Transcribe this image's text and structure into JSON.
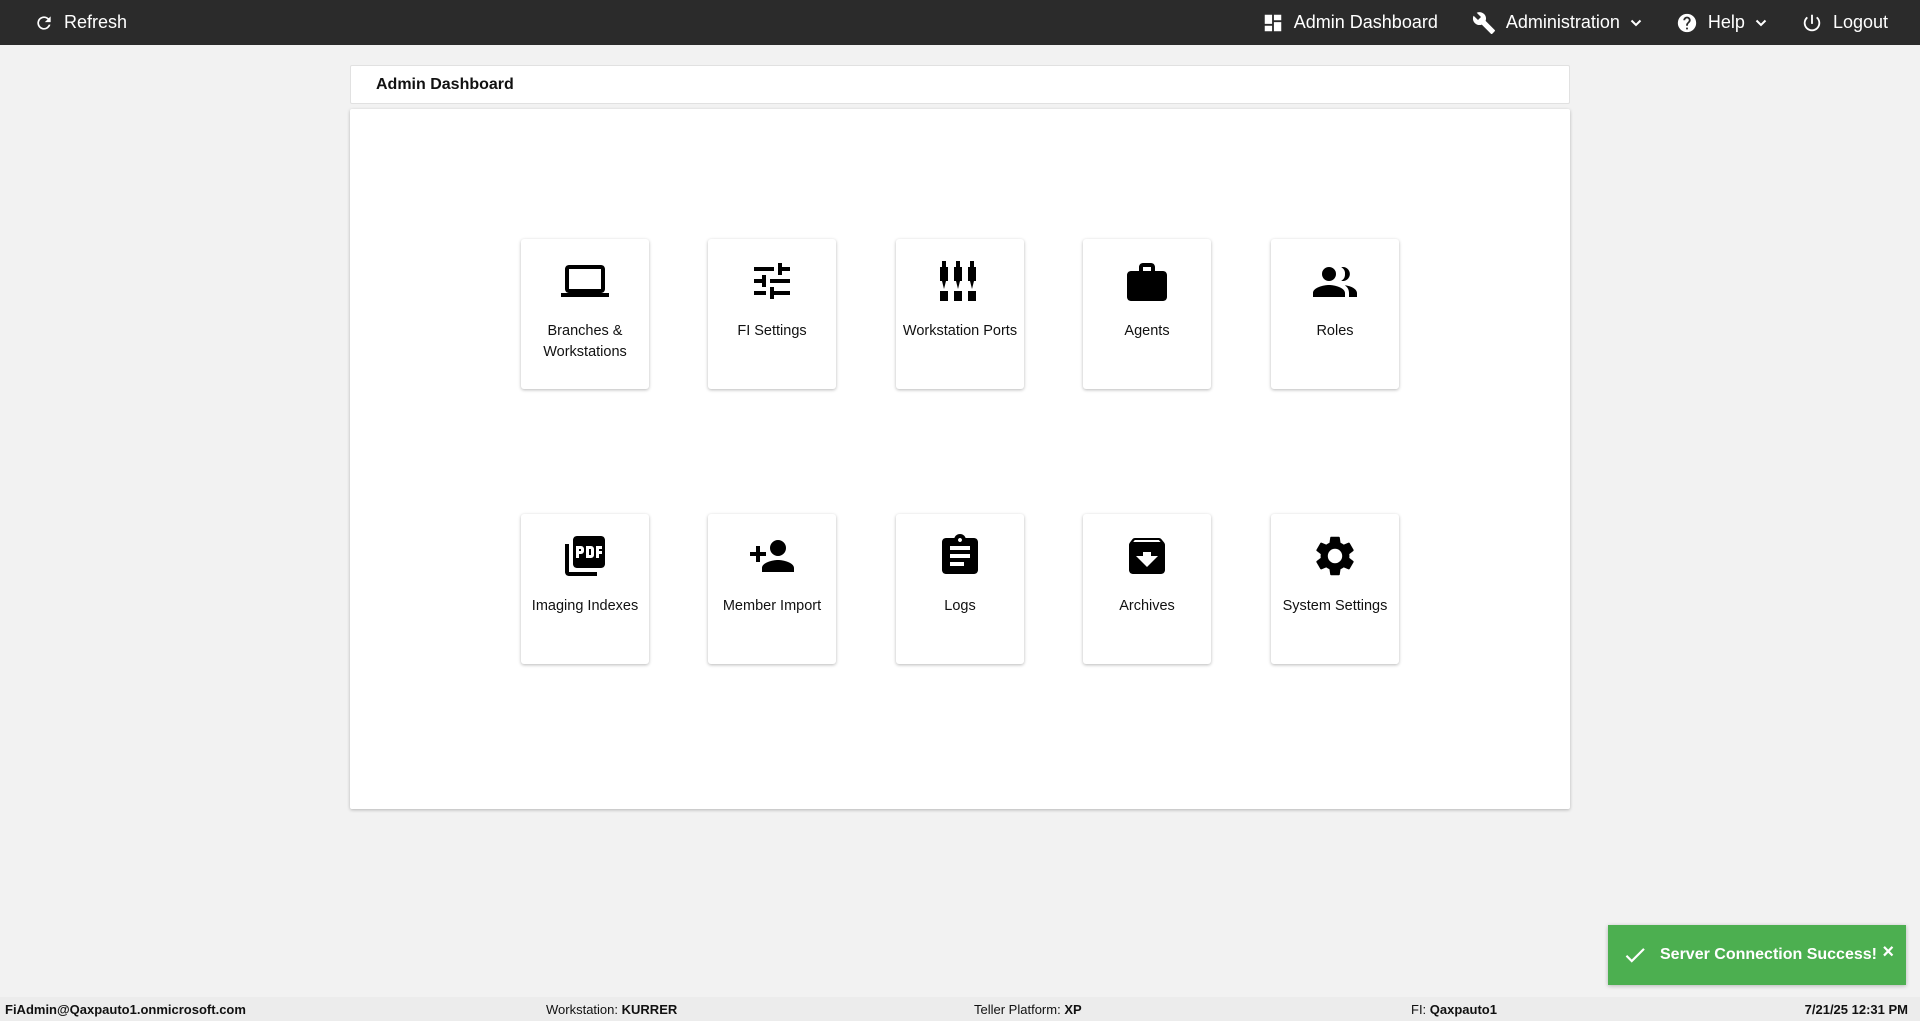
{
  "topbar": {
    "refresh_label": "Refresh",
    "admin_dashboard_label": "Admin Dashboard",
    "administration_label": "Administration",
    "help_label": "Help",
    "logout_label": "Logout",
    "background": "#2b2b2b"
  },
  "page": {
    "title": "Admin Dashboard"
  },
  "tiles": [
    {
      "label": "Branches & Workstations",
      "icon": "laptop-icon"
    },
    {
      "label": "FI Settings",
      "icon": "sliders-icon"
    },
    {
      "label": "Workstation Ports",
      "icon": "ports-icon"
    },
    {
      "label": "Agents",
      "icon": "briefcase-icon"
    },
    {
      "label": "Roles",
      "icon": "people-icon"
    },
    {
      "label": "Imaging Indexes",
      "icon": "pdf-icon"
    },
    {
      "label": "Member Import",
      "icon": "person-add-icon"
    },
    {
      "label": "Logs",
      "icon": "clipboard-icon"
    },
    {
      "label": "Archives",
      "icon": "archive-icon"
    },
    {
      "label": "System Settings",
      "icon": "gear-icon"
    }
  ],
  "toast": {
    "message": "Server Connection Success!",
    "close": "×",
    "color": "#4caf50"
  },
  "statusbar": {
    "user": "FiAdmin@Qaxpauto1.onmicrosoft.com",
    "workstation_label": "Workstation:",
    "workstation_value": "KURRER",
    "platform_label": "Teller Platform:",
    "platform_value": "XP",
    "fi_label": "FI:",
    "fi_value": "Qaxpauto1",
    "datetime": "7/21/25 12:31 PM"
  }
}
